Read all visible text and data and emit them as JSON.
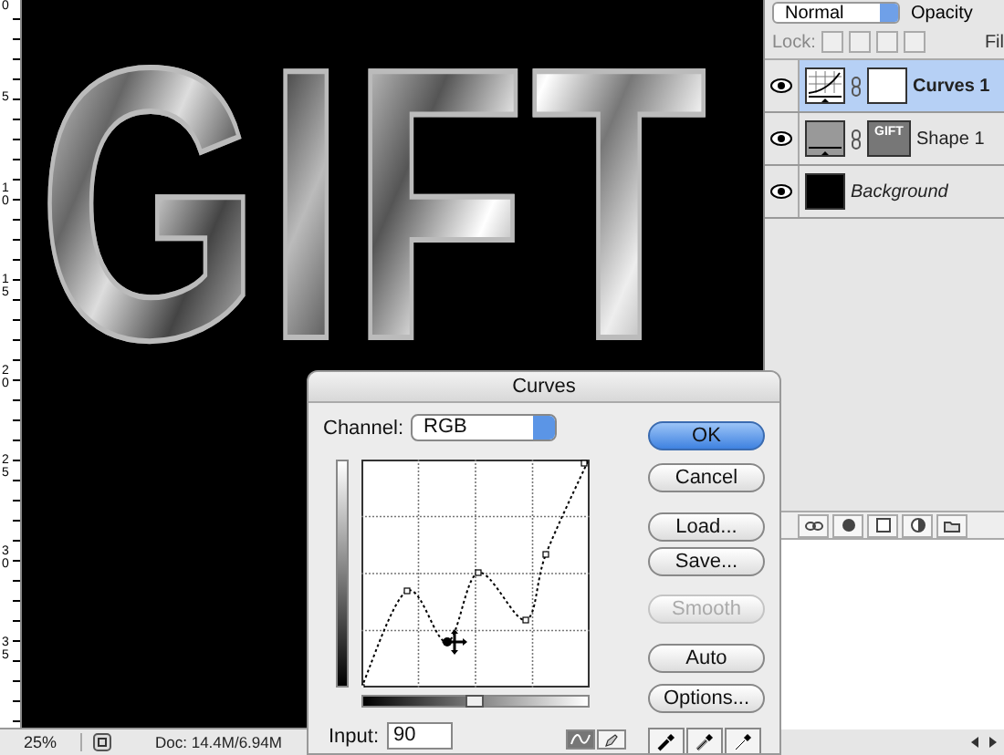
{
  "canvas": {
    "artwork_text": "GIFT",
    "ruler_labels": [
      "0",
      "5",
      "10",
      "15",
      "20",
      "25",
      "30",
      "35"
    ]
  },
  "status_bar": {
    "zoom": "25%",
    "document": "Doc: 14.4M/6.94M"
  },
  "layers_panel": {
    "blend_mode": "Normal",
    "opacity_label": "Opacity",
    "lock_label": "Lock:",
    "fill_label": "Fil",
    "layers": [
      {
        "name": "Curves 1",
        "kind": "adjustment",
        "selected": true,
        "visible": true
      },
      {
        "name": "Shape 1",
        "kind": "shape",
        "thumbnail_text": "GIFT",
        "selected": false,
        "visible": true
      },
      {
        "name": "Background",
        "kind": "background",
        "selected": false,
        "visible": true
      }
    ]
  },
  "curves_dialog": {
    "title": "Curves",
    "channel_label": "Channel:",
    "channel": "RGB",
    "input_label": "Input:",
    "input_value": "90",
    "buttons": [
      {
        "label": "OK",
        "default": true,
        "disabled": false
      },
      {
        "label": "Cancel",
        "default": false,
        "disabled": false
      },
      {
        "label": "Load...",
        "default": false,
        "disabled": false
      },
      {
        "label": "Save...",
        "default": false,
        "disabled": false
      },
      {
        "label": "Smooth",
        "default": false,
        "disabled": true
      },
      {
        "label": "Auto",
        "default": false,
        "disabled": false
      },
      {
        "label": "Options...",
        "default": false,
        "disabled": false
      }
    ],
    "tools": [
      {
        "kind": "curve",
        "selected": true
      },
      {
        "kind": "pencil",
        "selected": false
      }
    ]
  }
}
